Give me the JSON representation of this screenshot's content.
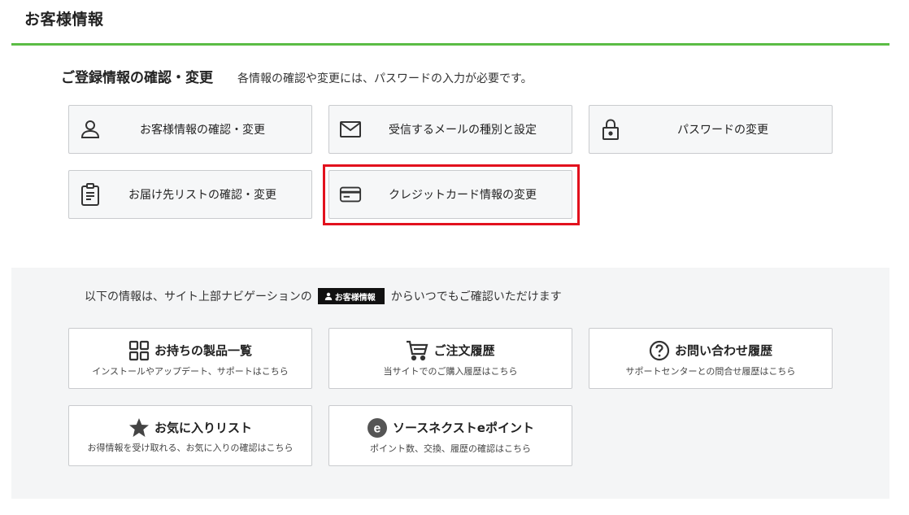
{
  "page": {
    "title": "お客様情報"
  },
  "registration": {
    "heading": "ご登録情報の確認・変更",
    "note": "各情報の確認や変更には、パスワードの入力が必要です。",
    "buttons": [
      {
        "label": "お客様情報の確認・変更",
        "icon": "person-icon"
      },
      {
        "label": "受信するメールの種別と設定",
        "icon": "mail-icon"
      },
      {
        "label": "パスワードの変更",
        "icon": "lock-icon"
      },
      {
        "label": "お届け先リストの確認・変更",
        "icon": "clipboard-icon"
      },
      {
        "label": "クレジットカード情報の変更",
        "icon": "credit-card-icon",
        "highlighted": true
      }
    ]
  },
  "info": {
    "lead_before": "以下の情報は、サイト上部ナビゲーションの",
    "badge_label": "お客様情報",
    "lead_after": "からいつでもご確認いただけます",
    "cards": [
      {
        "title": "お持ちの製品一覧",
        "sub": "インストールやアップデート、サポートはこちら",
        "icon": "grid-icon"
      },
      {
        "title": "ご注文履歴",
        "sub": "当サイトでのご購入履歴はこちら",
        "icon": "cart-icon"
      },
      {
        "title": "お問い合わせ履歴",
        "sub": "サポートセンターとの問合せ履歴はこちら",
        "icon": "question-circle-icon"
      },
      {
        "title": "お気に入りリスト",
        "sub": "お得情報を受け取れる、お気に入りの確認はこちら",
        "icon": "star-icon"
      },
      {
        "title": "ソースネクストeポイント",
        "sub": "ポイント数、交換、履歴の確認はこちら",
        "icon": "e-point-icon"
      }
    ]
  },
  "colors": {
    "accent_rule": "#5bbd45",
    "highlight": "#e2111d",
    "button_bg": "#f6f7f8",
    "info_bg": "#f4f5f6"
  }
}
